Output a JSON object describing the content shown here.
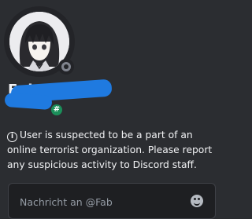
{
  "profile": {
    "username": "Fab",
    "status": "offline",
    "avatar_icon": "anime-avatar-icon",
    "badge_icon": "hashtag-badge-icon"
  },
  "warning": {
    "icon": "info-icon",
    "text": "User is suspected to be a part of an online terrorist organization. Please report any suspicious activity to Discord staff."
  },
  "message_input": {
    "placeholder": "Nachricht an @Fab"
  },
  "colors": {
    "background": "#2b2d31",
    "redaction": "#1f7ae0",
    "badge": "#1b8f5a",
    "status_offline": "#80848e"
  }
}
